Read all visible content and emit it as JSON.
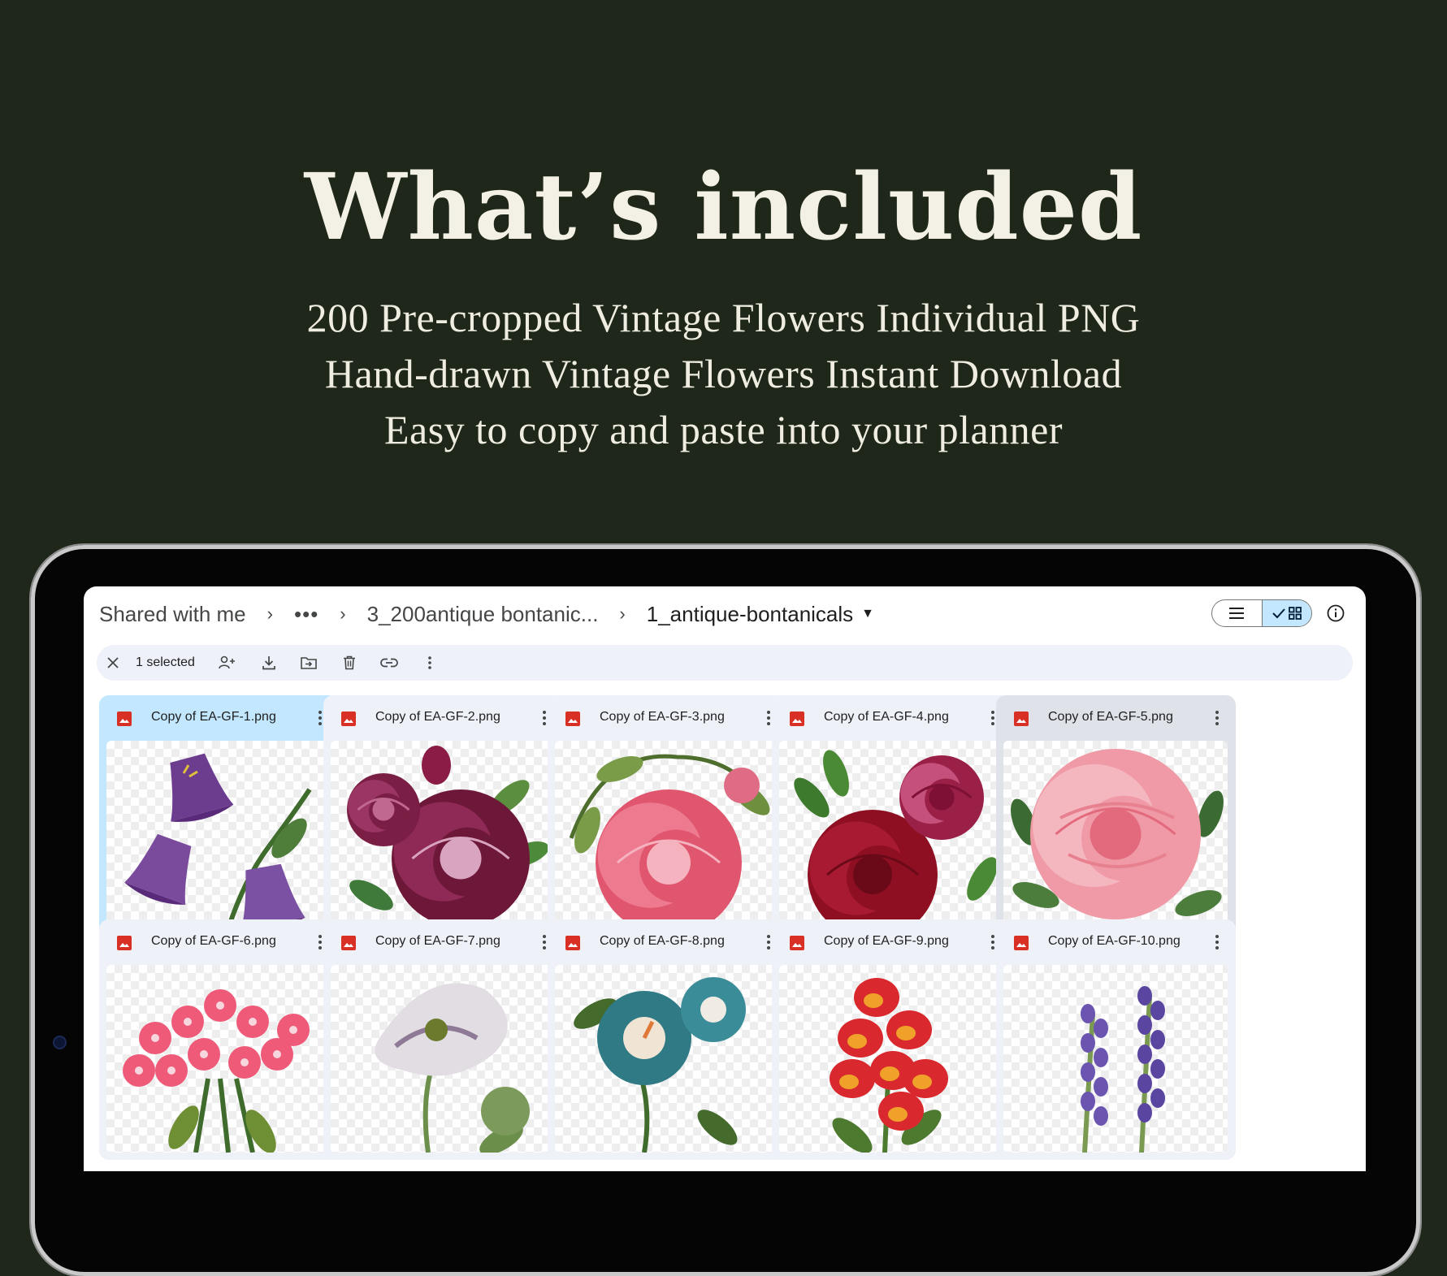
{
  "hero": {
    "title": "What’s included",
    "lines": [
      "200 Pre-cropped Vintage Flowers Individual PNG",
      "Hand-drawn Vintage Flowers Instant Download",
      "Easy to copy and paste into your planner"
    ]
  },
  "colors": {
    "background": "#1e271a",
    "text": "#f3f0e6",
    "selected_card": "#c2e7ff",
    "card": "#eef2f8",
    "file_icon": "#d93025"
  },
  "drive": {
    "breadcrumb": {
      "root": "Shared with me",
      "ellipsis": "•••",
      "parent": "3_200antique bontanic...",
      "current": "1_antique-bontanicals"
    },
    "view_toggle": {
      "list_icon": "list-icon",
      "grid_icon": "grid-icon",
      "active": "grid"
    },
    "action_bar": {
      "selected_label": "1 selected",
      "icons": [
        "close-icon",
        "share-icon",
        "download-icon",
        "move-icon",
        "trash-icon",
        "link-icon",
        "more-icon"
      ]
    },
    "files": [
      {
        "name": "Copy of EA-GF-1.png",
        "state": "selected",
        "flower": "purple bellflower"
      },
      {
        "name": "Copy of EA-GF-2.png",
        "state": "normal",
        "flower": "magenta rose"
      },
      {
        "name": "Copy of EA-GF-3.png",
        "state": "normal",
        "flower": "pink rose"
      },
      {
        "name": "Copy of EA-GF-4.png",
        "state": "normal",
        "flower": "crimson rose"
      },
      {
        "name": "Copy of EA-GF-5.png",
        "state": "hovered",
        "flower": "pink peony"
      },
      {
        "name": "Copy of EA-GF-6.png",
        "state": "normal",
        "flower": "pink flower cluster"
      },
      {
        "name": "Copy of EA-GF-7.png",
        "state": "normal",
        "flower": "white poppy"
      },
      {
        "name": "Copy of EA-GF-8.png",
        "state": "normal",
        "flower": "blue morning glory"
      },
      {
        "name": "Copy of EA-GF-9.png",
        "state": "normal",
        "flower": "red snapdragon"
      },
      {
        "name": "Copy of EA-GF-10.png",
        "state": "normal",
        "flower": "lavender"
      }
    ]
  }
}
